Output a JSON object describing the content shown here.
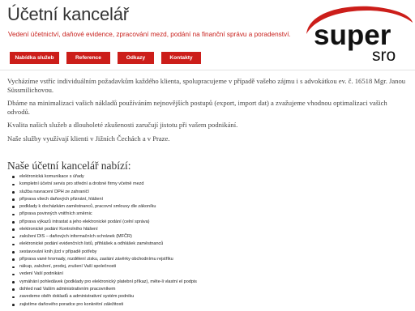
{
  "header": {
    "title": "Účetní kancelář",
    "tagline": "Vedení účetnictví, daňové evidence, zpracování mezd, podání na finanční správu a poradenství.",
    "logo": {
      "word": "super",
      "sub": "sro",
      "accent_color": "#cc1e1a"
    }
  },
  "nav": [
    {
      "label": "Nabídka služeb"
    },
    {
      "label": "Reference"
    },
    {
      "label": "Odkazy"
    },
    {
      "label": "Kontakty"
    }
  ],
  "intro": [
    "Vycházíme vstříc individuálním požadavkům každého klienta, spolupracujeme v případě vašeho zájmu i s advokátkou ev. č. 16518 Mgr. Janou Süssmilichovou.",
    "Dbáme na minimalizaci vašich nákladů používáním nejnovějších postupů (export, import dat) a zvažujeme vhodnou optimalizaci vašich odvodů.",
    "Kvalita našich služeb a dlouholeté zkušenosti zaručují jistotu při vašem podnikání.",
    "Naše služby využívají klienti v Jižních Čechách a v Praze."
  ],
  "services": {
    "heading": "Naše účetní kancelář nabízí:",
    "items": [
      "elektronická komunikace s úřady",
      "kompletní účetní servis pro střední a drobné firmy včetně mezd",
      "služba navracení DPH ze zahraničí",
      "příprava všech daňových přiznání, hlášení",
      "podklady k docházkám zaměstnanců, pracovní smlouvy dle zákoníku",
      "příprava povinných vnitřních směrnic",
      "příprava výkazů intrastat a jeho elektronické podání (celní správa)",
      "elektronické podání Kontrolního hlášení",
      "založení DIS – daňových informačních schránek (MFČR)",
      "elektronické podání evidenčních listů, přihlášek a odhlášek zaměstnanců",
      "sestavování knih jízd v případě potřeby",
      "příprava vané hromady, rozdělení zisku, zaslání závěrky obchodnímu rejstříku",
      "nákup, založení, prodej, zrušení Vaší společnosti",
      "vedení Vaší podnikání",
      "vymáhání pohledávek (podklady pro elektronický platební příkaz), měte-li vlastní el podpis",
      "dohled nad Vaším administrativním pracovníkem",
      "zavedeme oběh dokladů a administrativní systém podniku",
      "zajistíme daňového poradce pro konkrétní záležitosti"
    ]
  }
}
